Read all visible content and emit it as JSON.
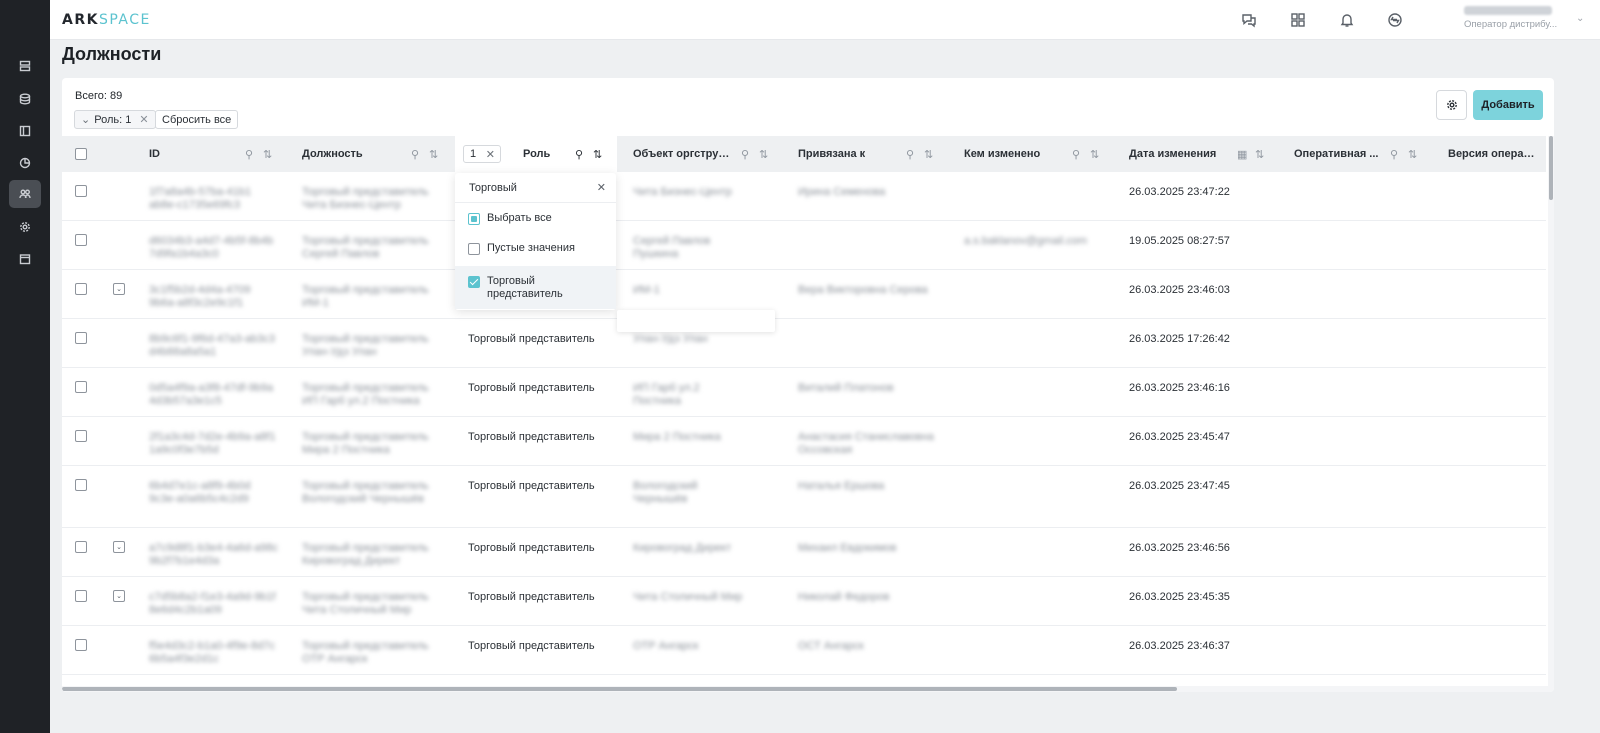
{
  "app": {
    "logo_bold": "ARK",
    "logo_light": "SPACE",
    "user_role": "Оператор дистрибу..."
  },
  "sidebar": {
    "items": [
      {
        "icon": "list-icon"
      },
      {
        "icon": "database-icon"
      },
      {
        "icon": "layout-icon"
      },
      {
        "icon": "chart-icon"
      },
      {
        "icon": "users-icon",
        "active": true
      },
      {
        "icon": "gear-icon"
      },
      {
        "icon": "calendar-icon"
      }
    ]
  },
  "header_icons": [
    "chat-icon",
    "apps-grid-icon",
    "bell-icon",
    "sync-icon"
  ],
  "page": {
    "title": "Должности"
  },
  "toolbar": {
    "total_label": "Всего: 89",
    "filter_chip": "Роль: 1",
    "reset_label": "Сбросить все",
    "add_label": "Добавить"
  },
  "table": {
    "columns": [
      {
        "key": "id",
        "label": "ID"
      },
      {
        "key": "position",
        "label": "Должность"
      },
      {
        "key": "role",
        "label": "Роль",
        "filter_count": "1"
      },
      {
        "key": "org",
        "label": "Объект оргструк..."
      },
      {
        "key": "bound",
        "label": "Привязана к"
      },
      {
        "key": "changed_by",
        "label": "Кем изменено"
      },
      {
        "key": "date",
        "label": "Дата изменения"
      },
      {
        "key": "operative",
        "label": "Оперативная ..."
      },
      {
        "key": "version",
        "label": "Версия операц..."
      }
    ],
    "rows": [
      {
        "role": "",
        "date": "26.03.2025 23:47:22",
        "expand": false,
        "id": "1f7a8a4b-57ba-41b1 ab8e-c1735e69fc3",
        "pos": "Торговый представитель Чита Бизнес-Центр",
        "org": "Чита Бизнес-Центр",
        "bound": "Ирина Семенова",
        "changed": ""
      },
      {
        "role": "",
        "date": "19.05.2025 08:27:57",
        "expand": false,
        "id": "d6034b3-a4d7-4b5f-8b4b 7d9fa1b4a3c0",
        "pos": "Торговый представитель Сергей Павлов",
        "org": "Сергей Павлов Пушкина",
        "bound": "",
        "changed": "a.s.baklanov@gmail.com"
      },
      {
        "role": "",
        "date": "26.03.2025 23:46:03",
        "expand": true,
        "id": "3c1f5b2d-4d4a-4709 9b6a-a8f3c2e9c1f1",
        "pos": "Торговый представитель ИМ-1",
        "org": "ИМ-1",
        "bound": "Вера Викторовна Серова",
        "changed": ""
      },
      {
        "role": "Торговый представитель",
        "date": "26.03.2025 17:26:42",
        "expand": false,
        "id": "8b9c6f1-9f6d-47a3-ab3c3 d4b88a8a5a1",
        "pos": "Торговый представитель Улан-Удэ Улан",
        "org": "Улан-Удэ Улан",
        "bound": "",
        "changed": ""
      },
      {
        "role": "Торговый представитель",
        "date": "26.03.2025 23:46:16",
        "expand": false,
        "id": "0d5a4f9a-a3f8-47df-9b9a 4d3b57a3e1c5",
        "pos": "Торговый представитель ИП Гарб ул.2 Постника",
        "org": "ИП Гарб ул.2 Постника",
        "bound": "Виталий Платонов",
        "changed": ""
      },
      {
        "role": "Торговый представитель",
        "date": "26.03.2025 23:45:47",
        "expand": false,
        "id": "2f1a3c4d-7d2e-4b9a-a8f1 1a9c0f3e7b5d",
        "pos": "Торговый представитель Мира 2 Постника",
        "org": "Мира 2 Постника",
        "bound": "Анастасия Станиславовна Оссовская",
        "changed": ""
      },
      {
        "role": "Торговый представитель",
        "date": "26.03.2025 23:47:45",
        "expand": false,
        "id": "6b4d7e1c-a8f9-4b0d 9c3e-a0a6b5c4c2d9",
        "pos": "Торговый представитель Вологодский Чернышёв",
        "org": "Вологодский Чернышёв",
        "bound": "Наталья Ершова",
        "changed": ""
      },
      {
        "role": "Торговый представитель",
        "date": "26.03.2025 23:46:56",
        "expand": true,
        "id": "a7c9d8f1-b3e4-4a6d-a98c 9b2f7b1e4d3a",
        "pos": "Торговый представитель Кировоград Директ",
        "org": "Кировоград Директ",
        "bound": "Михаил Евдокимов",
        "changed": ""
      },
      {
        "role": "Торговый представитель",
        "date": "26.03.2025 23:45:35",
        "expand": true,
        "id": "c7d5b8a2-f1e3-4a9d-9b1f 8e6d4c2b1a09",
        "pos": "Торговый представитель Чита Столичный Мир",
        "org": "Чита Столичный Мир",
        "bound": "Николай Федоров",
        "changed": ""
      },
      {
        "role": "Торговый представитель",
        "date": "26.03.2025 23:46:37",
        "expand": false,
        "id": "f5e4d3c2-b1a0-4f9e-8d7c 6b5a4f3e2d1c",
        "pos": "Торговый представитель ОТР Ангарск",
        "org": "ОТР Ангарск",
        "bound": "ОСТ Ангарск",
        "changed": ""
      }
    ]
  },
  "role_filter": {
    "search_value": "Торговый",
    "select_all": "Выбрать все",
    "empty_values": "Пустые значения",
    "option": "Торговый представитель"
  }
}
